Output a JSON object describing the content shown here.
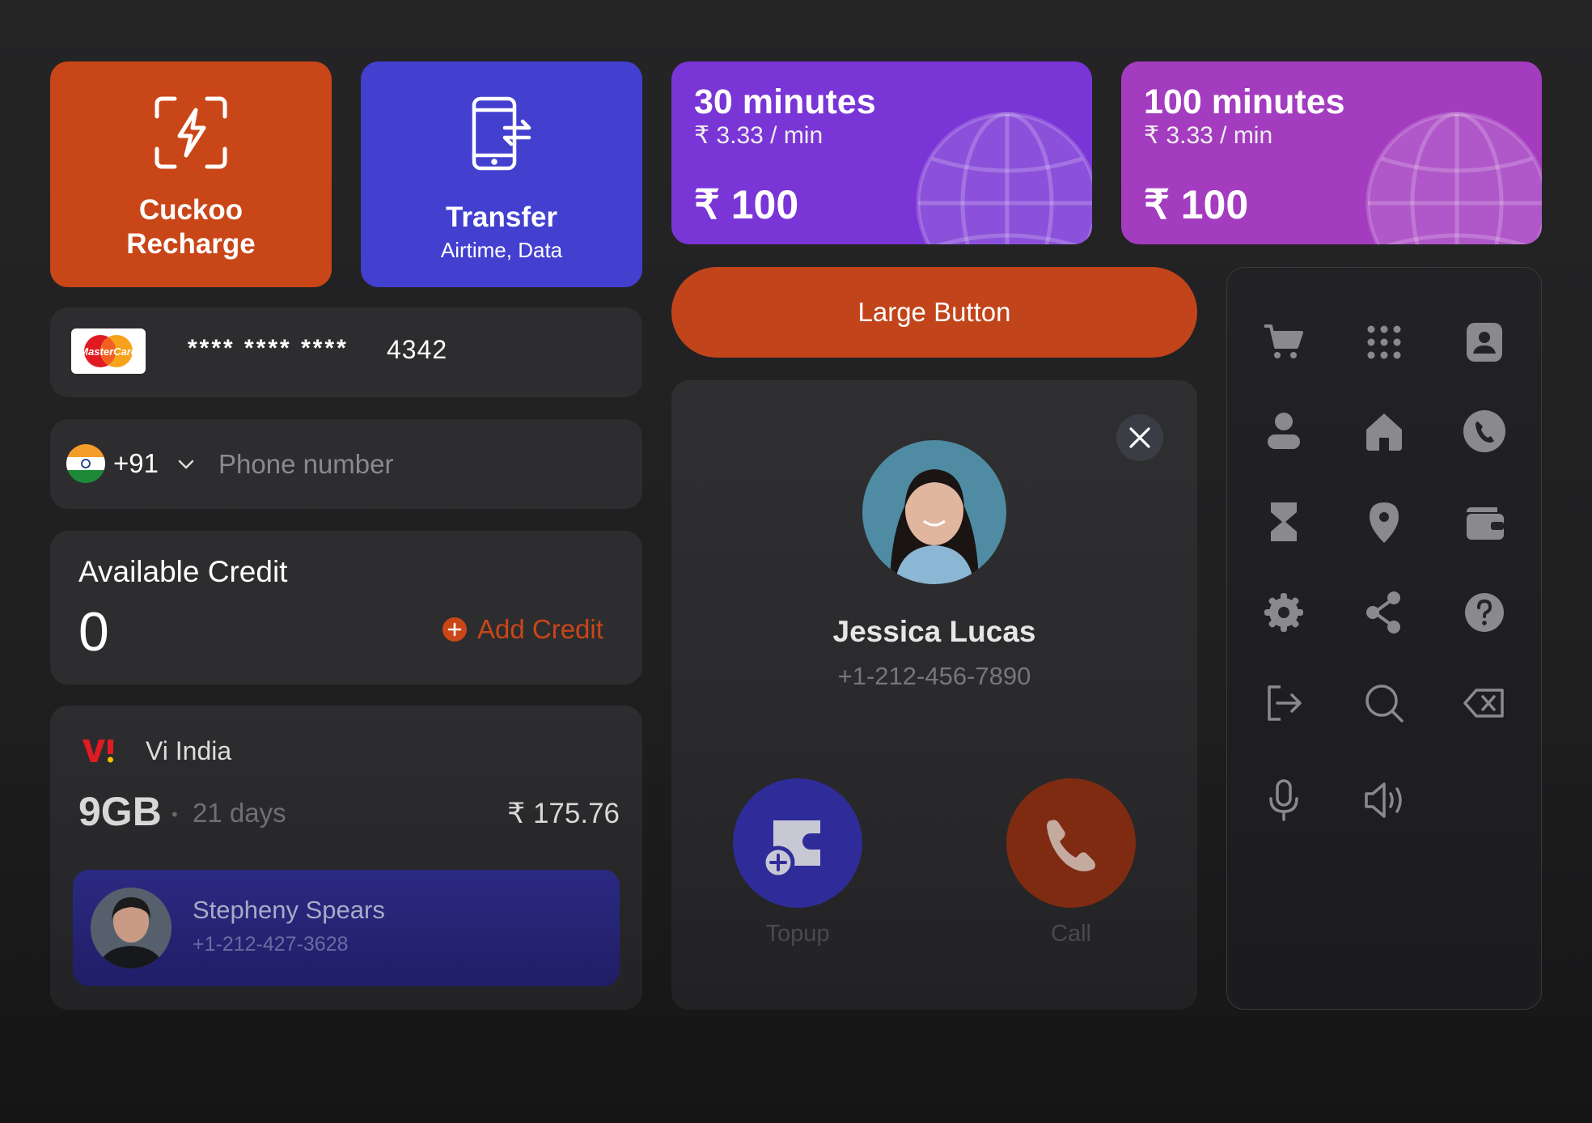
{
  "tiles": {
    "recharge": {
      "line1": "Cuckoo",
      "line2": "Recharge",
      "icon": "scan-lightning-icon",
      "color": "#c94618"
    },
    "transfer": {
      "title": "Transfer",
      "subtitle": "Airtime, Data",
      "icon": "phone-transfer-icon",
      "color": "#4340d0"
    }
  },
  "plans": [
    {
      "minutes": "30 minutes",
      "rate": "₹ 3.33 / min",
      "price": "₹ 100",
      "color": "#7a35d6",
      "icon": "globe-icon"
    },
    {
      "minutes": "100 minutes",
      "rate": "₹ 3.33 / min",
      "price": "₹ 100",
      "color": "#a43cc0",
      "icon": "globe-icon"
    }
  ],
  "card": {
    "brand": "MasterCard",
    "masked": "****   ****   ****",
    "last4": "4342"
  },
  "phone": {
    "country_code": "+91",
    "placeholder": "Phone number",
    "flag": "india-flag-icon"
  },
  "credit": {
    "label": "Available Credit",
    "amount": "0",
    "add_label": "Add Credit",
    "accent": "#c94618"
  },
  "operator": {
    "name": "Vi India",
    "data": "9GB",
    "validity": "21 days",
    "price": "₹ 175.76",
    "contact_name": "Stepheny Spears",
    "contact_number": "+1-212-427-3628"
  },
  "large_button": {
    "label": "Large Button"
  },
  "call_card": {
    "name": "Jessica Lucas",
    "number": "+1-212-456-7890",
    "topup_label": "Topup",
    "call_label": "Call"
  },
  "icon_palette": [
    "cart-icon",
    "grid-dots-icon",
    "contact-card-icon",
    "user-icon",
    "home-icon",
    "phone-circle-icon",
    "hourglass-icon",
    "location-pin-icon",
    "wallet-icon",
    "settings-icon",
    "share-icon",
    "help-icon",
    "logout-icon",
    "search-icon",
    "backspace-icon",
    "microphone-icon",
    "speaker-icon"
  ]
}
